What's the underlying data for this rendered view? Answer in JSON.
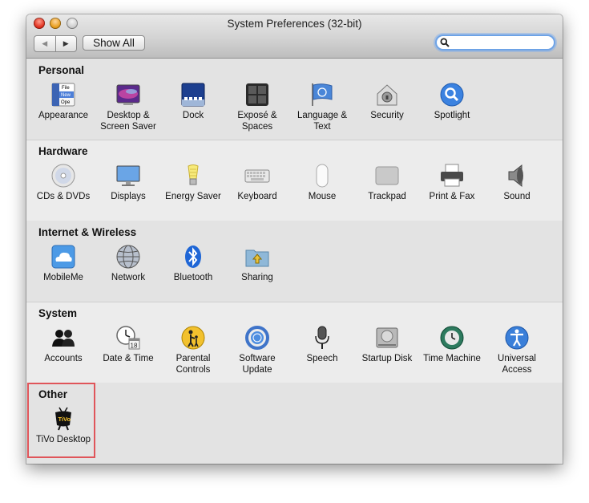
{
  "window": {
    "title": "System Preferences (32-bit)"
  },
  "toolbar": {
    "back_label": "◀",
    "forward_label": "▶",
    "show_all_label": "Show All",
    "search_value": "",
    "search_placeholder": ""
  },
  "sections": [
    {
      "title": "Personal",
      "items": [
        {
          "label": "Appearance",
          "icon": "appearance-icon"
        },
        {
          "label": "Desktop & Screen Saver",
          "icon": "desktop-icon"
        },
        {
          "label": "Dock",
          "icon": "dock-icon"
        },
        {
          "label": "Exposé & Spaces",
          "icon": "expose-icon"
        },
        {
          "label": "Language & Text",
          "icon": "flag-icon"
        },
        {
          "label": "Security",
          "icon": "house-lock-icon"
        },
        {
          "label": "Spotlight",
          "icon": "spotlight-icon"
        }
      ]
    },
    {
      "title": "Hardware",
      "items": [
        {
          "label": "CDs & DVDs",
          "icon": "disc-icon"
        },
        {
          "label": "Displays",
          "icon": "monitor-icon"
        },
        {
          "label": "Energy Saver",
          "icon": "lightbulb-icon"
        },
        {
          "label": "Keyboard",
          "icon": "keyboard-icon"
        },
        {
          "label": "Mouse",
          "icon": "mouse-icon"
        },
        {
          "label": "Trackpad",
          "icon": "trackpad-icon"
        },
        {
          "label": "Print & Fax",
          "icon": "printer-icon"
        },
        {
          "label": "Sound",
          "icon": "speaker-icon"
        }
      ]
    },
    {
      "title": "Internet & Wireless",
      "items": [
        {
          "label": "MobileMe",
          "icon": "cloud-icon"
        },
        {
          "label": "Network",
          "icon": "globe-icon"
        },
        {
          "label": "Bluetooth",
          "icon": "bluetooth-icon"
        },
        {
          "label": "Sharing",
          "icon": "folder-sharing-icon"
        }
      ]
    },
    {
      "title": "System",
      "items": [
        {
          "label": "Accounts",
          "icon": "users-icon"
        },
        {
          "label": "Date & Time",
          "icon": "clock-calendar-icon"
        },
        {
          "label": "Parental Controls",
          "icon": "parental-icon"
        },
        {
          "label": "Software Update",
          "icon": "update-icon"
        },
        {
          "label": "Speech",
          "icon": "microphone-icon"
        },
        {
          "label": "Startup Disk",
          "icon": "hard-disk-icon"
        },
        {
          "label": "Time Machine",
          "icon": "time-machine-icon"
        },
        {
          "label": "Universal Access",
          "icon": "accessibility-icon"
        }
      ]
    },
    {
      "title": "Other",
      "items": [
        {
          "label": "TiVo Desktop",
          "icon": "tivo-icon"
        }
      ]
    }
  ],
  "tivo_logo_text": "TiVo",
  "calendar_day": "18",
  "appearance_menu_items": [
    "File",
    "New",
    "Ope"
  ],
  "colors": {
    "highlight_border": "#e0555a",
    "search_focus": "#6ea3e6"
  }
}
